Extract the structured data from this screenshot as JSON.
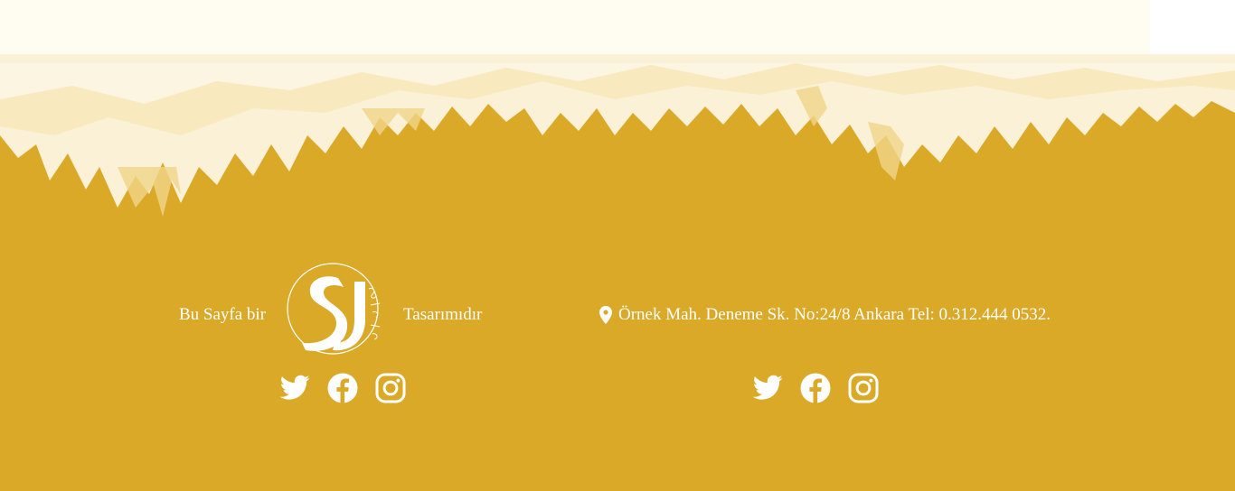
{
  "footer": {
    "credit_prefix": "Bu Sayfa bir",
    "credit_suffix": "Tasarımıdır",
    "address": "Örnek Mah. Deneme Sk. No:24/8 Ankara Tel: 0.312.444 0532.",
    "logo_text": "SJ",
    "social_icons": [
      "twitter-icon",
      "facebook-icon",
      "instagram-icon"
    ]
  },
  "colors": {
    "background": "#dba928",
    "top_paint": "#fffcf2",
    "text": "#ffffff"
  }
}
